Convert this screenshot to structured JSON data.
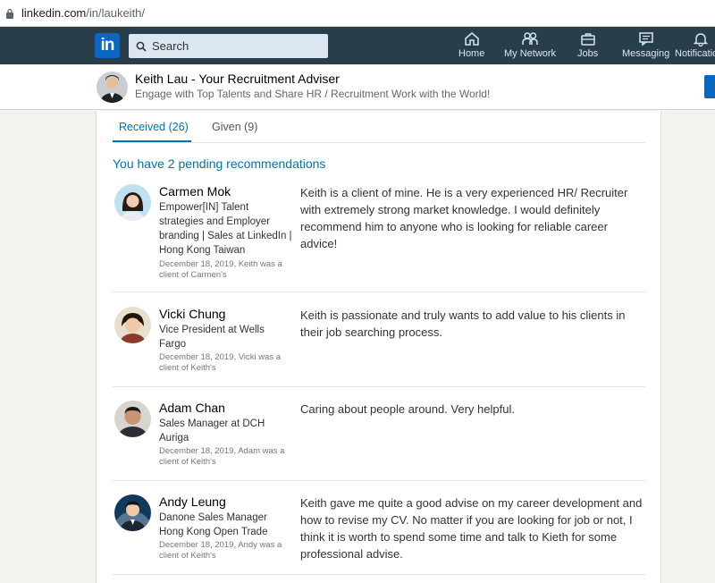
{
  "browser": {
    "url_domain": "linkedin.com",
    "url_path": "/in/laukeith/"
  },
  "nav": {
    "logo_text": "in",
    "search_placeholder": "Search",
    "items": [
      {
        "label": "Home",
        "icon": "home-icon"
      },
      {
        "label": "My Network",
        "icon": "people-icon"
      },
      {
        "label": "Jobs",
        "icon": "briefcase-icon"
      },
      {
        "label": "Messaging",
        "icon": "chat-icon"
      },
      {
        "label": "Notificatio",
        "icon": "bell-icon"
      }
    ]
  },
  "profile": {
    "name": "Keith Lau - Your Recruitment Adviser",
    "headline": "Engage with Top Talents and Share HR / Recruitment Work with the World!"
  },
  "recommendations": {
    "tabs": [
      {
        "label": "Received (26)",
        "active": true
      },
      {
        "label": "Given (9)",
        "active": false
      }
    ],
    "pending_text": "You have 2 pending recommendations",
    "items": [
      {
        "name": "Carmen Mok",
        "title": "Empower[IN] Talent strategies and Employer branding | Sales at LinkedIn | Hong Kong Taiwan",
        "meta": "December 18, 2019, Keith was a client of Carmen's",
        "text": "Keith is a client of mine. He is a very experienced HR/ Recruiter with extremely strong market knowledge. I would definitely recommend him to anyone who is looking for reliable career advice!"
      },
      {
        "name": "Vicki Chung",
        "title": "Vice President at Wells Fargo",
        "meta": "December 18, 2019, Vicki was a client of Keith's",
        "text": "Keith is passionate and truly wants to add value to his clients in their job searching process."
      },
      {
        "name": "Adam Chan",
        "title": "Sales Manager at DCH Auriga",
        "meta": "December 18, 2019, Adam was a client of Keith's",
        "text": "Caring about people around. Very helpful."
      },
      {
        "name": "Andy Leung",
        "title": "Danone Sales Manager Hong Kong Open Trade",
        "meta": "December 18, 2019, Andy was a client of Keith's",
        "text": "Keith gave me quite a good advise on my career development and how to revise my CV. No matter if you are looking for job or not, I think it is worth to spend some time and talk to Kieth for some professional advise."
      }
    ]
  },
  "colors": {
    "nav_bg": "#283e4a",
    "linkedin_blue": "#0a66c2",
    "link_blue": "#0073b1"
  }
}
